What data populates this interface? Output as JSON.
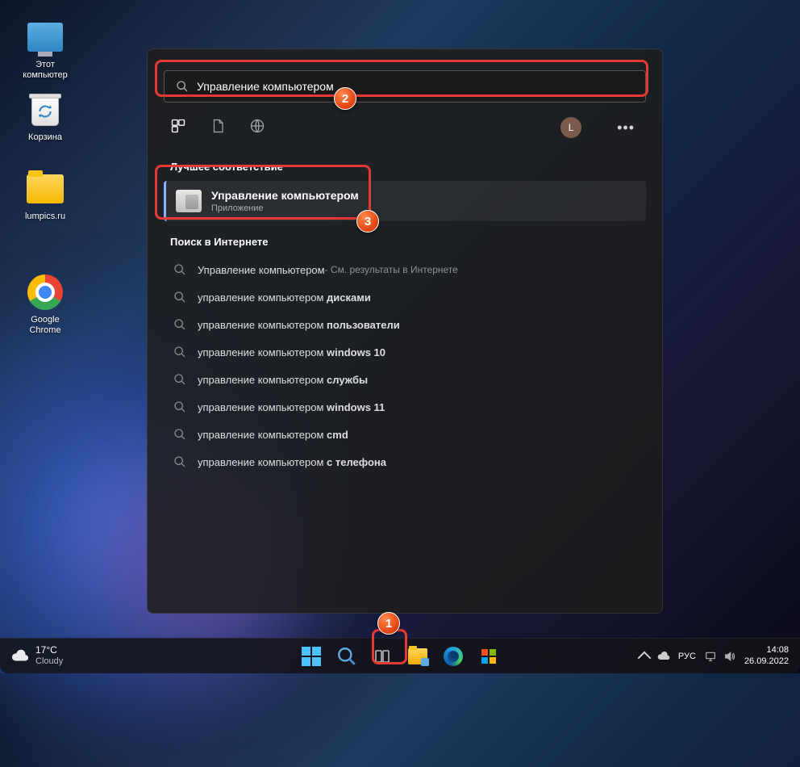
{
  "desktop": {
    "icons": [
      {
        "label": "Этот\nкомпьютер"
      },
      {
        "label": "Корзина"
      },
      {
        "label": "lumpics.ru"
      },
      {
        "label": "Google\nChrome"
      }
    ]
  },
  "search": {
    "query": "Управление компьютером",
    "best_match_title": "Лучшее соответствие",
    "best_match": {
      "title": "Управление компьютером",
      "subtitle": "Приложение"
    },
    "web_title": "Поиск в Интернете",
    "user_initial": "L",
    "web_results": [
      {
        "prefix": "Управление компьютером",
        "bold": "",
        "suffix": " - См. результаты в Интернете"
      },
      {
        "prefix": "управление компьютером ",
        "bold": "дисками",
        "suffix": ""
      },
      {
        "prefix": "управление компьютером ",
        "bold": "пользователи",
        "suffix": ""
      },
      {
        "prefix": "управление компьютером ",
        "bold": "windows 10",
        "suffix": ""
      },
      {
        "prefix": "управление компьютером ",
        "bold": "службы",
        "suffix": ""
      },
      {
        "prefix": "управление компьютером ",
        "bold": "windows 11",
        "suffix": ""
      },
      {
        "prefix": "управление компьютером ",
        "bold": "cmd",
        "suffix": ""
      },
      {
        "prefix": "управление компьютером ",
        "bold": "с телефона",
        "suffix": ""
      }
    ]
  },
  "taskbar": {
    "weather": {
      "temp": "17°C",
      "cond": "Cloudy"
    },
    "lang": "РУС",
    "time": "14:08",
    "date": "26.09.2022"
  },
  "callouts": {
    "c1": "1",
    "c2": "2",
    "c3": "3"
  }
}
